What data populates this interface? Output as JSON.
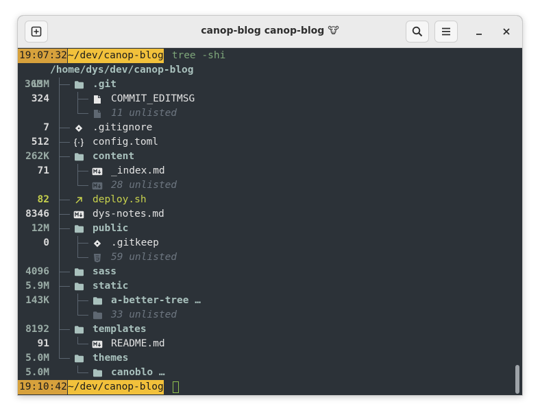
{
  "window": {
    "title": "canop-blog canop-blog 🐮"
  },
  "prompt1": {
    "time": "19:07:32",
    "path": "~/dev/canop-blog",
    "command": " tree -shi"
  },
  "root": {
    "size": "36M",
    "path": "/home/dys/dev/canop-blog"
  },
  "rows": [
    {
      "size": "13M",
      "name": ".git",
      "kind": "dir",
      "depth": 0,
      "icon": "folder-icon"
    },
    {
      "size": "324",
      "name": "COMMIT_EDITMSG",
      "kind": "file",
      "depth": 1,
      "icon": "file-icon"
    },
    {
      "size": "",
      "name": "11 unlisted",
      "kind": "unlisted",
      "depth": 1,
      "icon": "file-icon"
    },
    {
      "size": "7",
      "name": ".gitignore",
      "kind": "file",
      "depth": 0,
      "icon": "git-icon"
    },
    {
      "size": "512",
      "name": "config.toml",
      "kind": "file",
      "depth": 0,
      "icon": "braces-icon"
    },
    {
      "size": "262K",
      "name": "content",
      "kind": "dir",
      "depth": 0,
      "icon": "folder-icon"
    },
    {
      "size": "71",
      "name": "_index.md",
      "kind": "file",
      "depth": 1,
      "icon": "markdown-icon"
    },
    {
      "size": "",
      "name": "28 unlisted",
      "kind": "unlisted",
      "depth": 1,
      "icon": "markdown-icon"
    },
    {
      "size": "82",
      "name": "deploy.sh",
      "kind": "exec",
      "depth": 0,
      "icon": "arrow-up-right-icon"
    },
    {
      "size": "8346",
      "name": "dys-notes.md",
      "kind": "file",
      "depth": 0,
      "icon": "markdown-icon"
    },
    {
      "size": "12M",
      "name": "public",
      "kind": "dir",
      "depth": 0,
      "icon": "folder-icon"
    },
    {
      "size": "0",
      "name": ".gitkeep",
      "kind": "file",
      "depth": 1,
      "icon": "git-icon"
    },
    {
      "size": "",
      "name": "59 unlisted",
      "kind": "unlisted",
      "depth": 1,
      "icon": "html-icon"
    },
    {
      "size": "4096",
      "name": "sass",
      "kind": "dir",
      "depth": 0,
      "icon": "folder-icon"
    },
    {
      "size": "5.9M",
      "name": "static",
      "kind": "dir",
      "depth": 0,
      "icon": "folder-icon"
    },
    {
      "size": "143K",
      "name": "a-better-tree …",
      "kind": "dir",
      "depth": 1,
      "icon": "folder-icon"
    },
    {
      "size": "",
      "name": "33 unlisted",
      "kind": "unlisted",
      "depth": 1,
      "icon": "folder-icon"
    },
    {
      "size": "8192",
      "name": "templates",
      "kind": "dir",
      "depth": 0,
      "icon": "folder-icon"
    },
    {
      "size": "91",
      "name": "README.md",
      "kind": "file",
      "depth": 1,
      "icon": "markdown-icon"
    },
    {
      "size": "5.0M",
      "name": "themes",
      "kind": "dir",
      "depth": 0,
      "icon": "folder-icon"
    },
    {
      "size": "5.0M",
      "name": "canoblo …",
      "kind": "dir",
      "depth": 1,
      "icon": "folder-icon"
    }
  ],
  "prompt2": {
    "time": "19:10:42",
    "path": "~/dev/canop-blog"
  },
  "colors": {
    "background": "#2c3238",
    "prompt_time_bg": "#d7a13c",
    "prompt_path_bg": "#f2c13b",
    "directory": "#a9c1bd",
    "executable": "#c7d14d",
    "unlisted": "#6d7680"
  }
}
